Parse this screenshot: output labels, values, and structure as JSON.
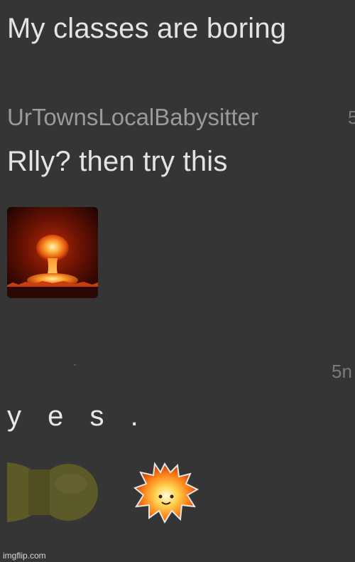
{
  "post": {
    "text": "My classes are boring"
  },
  "reply1": {
    "username": "UrTownsLocalBabysitter",
    "timestamp": "5",
    "text": "Rlly? then try this",
    "image": "nuclear-mushroom-cloud-image"
  },
  "reply2": {
    "timestamp": "5n",
    "text": "y e s .",
    "stickers": [
      "olive-bomb-sticker",
      "explosion-face-sticker"
    ]
  },
  "watermark": "imgflip.com",
  "colors": {
    "background": "#353535",
    "primary_text": "#e4e4e4",
    "username_text": "#9a9a9a",
    "timestamp_text": "#7a7a7a"
  }
}
